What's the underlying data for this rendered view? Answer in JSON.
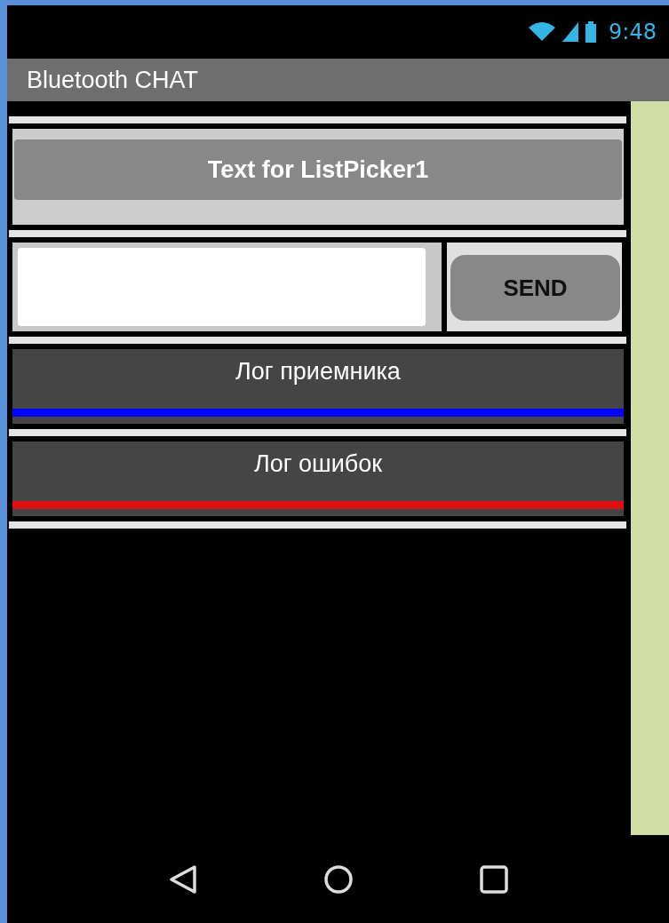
{
  "status_bar": {
    "time": "9:48"
  },
  "title_bar": {
    "title": "Bluetooth CHAT"
  },
  "list_picker": {
    "label": "Text for ListPicker1"
  },
  "send_button": {
    "label": "SEND"
  },
  "logs": [
    {
      "label": "Лог приемника",
      "color": "#0000ff"
    },
    {
      "label": "Лог ошибок",
      "color": "#dd1111"
    }
  ]
}
